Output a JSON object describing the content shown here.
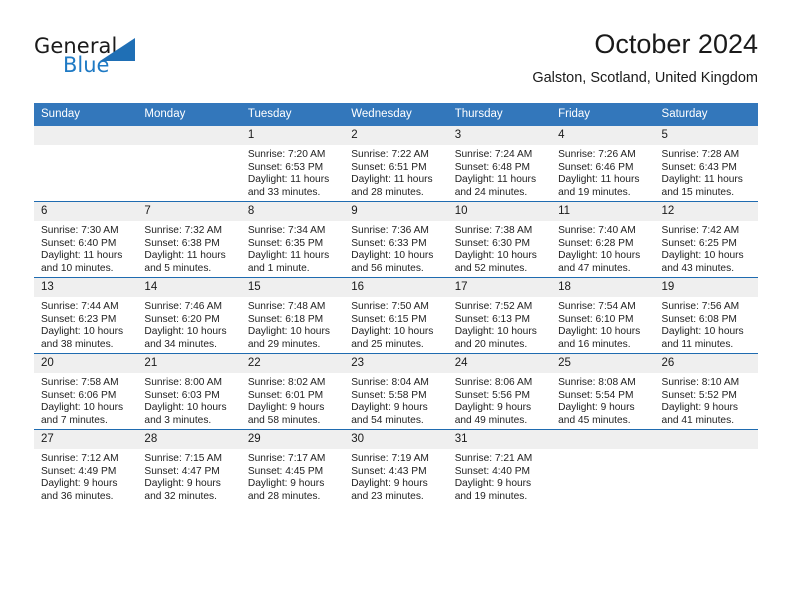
{
  "brand": {
    "name_part1": "General",
    "name_part2": "Blue",
    "logo_icon": "triangle-icon"
  },
  "header": {
    "title": "October 2024",
    "subtitle": "Galston, Scotland, United Kingdom"
  },
  "colors": {
    "header_blue": "#3377bb",
    "row_divider_blue": "#1f6bb0",
    "daynum_band": "#efefef",
    "brand_blue": "#1f7ac4",
    "text": "#1a1a1a"
  },
  "weekday_headers": [
    "Sunday",
    "Monday",
    "Tuesday",
    "Wednesday",
    "Thursday",
    "Friday",
    "Saturday"
  ],
  "weeks": [
    [
      {
        "day": "",
        "blank": true
      },
      {
        "day": "",
        "blank": true
      },
      {
        "day": "1",
        "sunrise": "Sunrise: 7:20 AM",
        "sunset": "Sunset: 6:53 PM",
        "daylight": "Daylight: 11 hours and 33 minutes."
      },
      {
        "day": "2",
        "sunrise": "Sunrise: 7:22 AM",
        "sunset": "Sunset: 6:51 PM",
        "daylight": "Daylight: 11 hours and 28 minutes."
      },
      {
        "day": "3",
        "sunrise": "Sunrise: 7:24 AM",
        "sunset": "Sunset: 6:48 PM",
        "daylight": "Daylight: 11 hours and 24 minutes."
      },
      {
        "day": "4",
        "sunrise": "Sunrise: 7:26 AM",
        "sunset": "Sunset: 6:46 PM",
        "daylight": "Daylight: 11 hours and 19 minutes."
      },
      {
        "day": "5",
        "sunrise": "Sunrise: 7:28 AM",
        "sunset": "Sunset: 6:43 PM",
        "daylight": "Daylight: 11 hours and 15 minutes."
      }
    ],
    [
      {
        "day": "6",
        "sunrise": "Sunrise: 7:30 AM",
        "sunset": "Sunset: 6:40 PM",
        "daylight": "Daylight: 11 hours and 10 minutes."
      },
      {
        "day": "7",
        "sunrise": "Sunrise: 7:32 AM",
        "sunset": "Sunset: 6:38 PM",
        "daylight": "Daylight: 11 hours and 5 minutes."
      },
      {
        "day": "8",
        "sunrise": "Sunrise: 7:34 AM",
        "sunset": "Sunset: 6:35 PM",
        "daylight": "Daylight: 11 hours and 1 minute."
      },
      {
        "day": "9",
        "sunrise": "Sunrise: 7:36 AM",
        "sunset": "Sunset: 6:33 PM",
        "daylight": "Daylight: 10 hours and 56 minutes."
      },
      {
        "day": "10",
        "sunrise": "Sunrise: 7:38 AM",
        "sunset": "Sunset: 6:30 PM",
        "daylight": "Daylight: 10 hours and 52 minutes."
      },
      {
        "day": "11",
        "sunrise": "Sunrise: 7:40 AM",
        "sunset": "Sunset: 6:28 PM",
        "daylight": "Daylight: 10 hours and 47 minutes."
      },
      {
        "day": "12",
        "sunrise": "Sunrise: 7:42 AM",
        "sunset": "Sunset: 6:25 PM",
        "daylight": "Daylight: 10 hours and 43 minutes."
      }
    ],
    [
      {
        "day": "13",
        "sunrise": "Sunrise: 7:44 AM",
        "sunset": "Sunset: 6:23 PM",
        "daylight": "Daylight: 10 hours and 38 minutes."
      },
      {
        "day": "14",
        "sunrise": "Sunrise: 7:46 AM",
        "sunset": "Sunset: 6:20 PM",
        "daylight": "Daylight: 10 hours and 34 minutes."
      },
      {
        "day": "15",
        "sunrise": "Sunrise: 7:48 AM",
        "sunset": "Sunset: 6:18 PM",
        "daylight": "Daylight: 10 hours and 29 minutes."
      },
      {
        "day": "16",
        "sunrise": "Sunrise: 7:50 AM",
        "sunset": "Sunset: 6:15 PM",
        "daylight": "Daylight: 10 hours and 25 minutes."
      },
      {
        "day": "17",
        "sunrise": "Sunrise: 7:52 AM",
        "sunset": "Sunset: 6:13 PM",
        "daylight": "Daylight: 10 hours and 20 minutes."
      },
      {
        "day": "18",
        "sunrise": "Sunrise: 7:54 AM",
        "sunset": "Sunset: 6:10 PM",
        "daylight": "Daylight: 10 hours and 16 minutes."
      },
      {
        "day": "19",
        "sunrise": "Sunrise: 7:56 AM",
        "sunset": "Sunset: 6:08 PM",
        "daylight": "Daylight: 10 hours and 11 minutes."
      }
    ],
    [
      {
        "day": "20",
        "sunrise": "Sunrise: 7:58 AM",
        "sunset": "Sunset: 6:06 PM",
        "daylight": "Daylight: 10 hours and 7 minutes."
      },
      {
        "day": "21",
        "sunrise": "Sunrise: 8:00 AM",
        "sunset": "Sunset: 6:03 PM",
        "daylight": "Daylight: 10 hours and 3 minutes."
      },
      {
        "day": "22",
        "sunrise": "Sunrise: 8:02 AM",
        "sunset": "Sunset: 6:01 PM",
        "daylight": "Daylight: 9 hours and 58 minutes."
      },
      {
        "day": "23",
        "sunrise": "Sunrise: 8:04 AM",
        "sunset": "Sunset: 5:58 PM",
        "daylight": "Daylight: 9 hours and 54 minutes."
      },
      {
        "day": "24",
        "sunrise": "Sunrise: 8:06 AM",
        "sunset": "Sunset: 5:56 PM",
        "daylight": "Daylight: 9 hours and 49 minutes."
      },
      {
        "day": "25",
        "sunrise": "Sunrise: 8:08 AM",
        "sunset": "Sunset: 5:54 PM",
        "daylight": "Daylight: 9 hours and 45 minutes."
      },
      {
        "day": "26",
        "sunrise": "Sunrise: 8:10 AM",
        "sunset": "Sunset: 5:52 PM",
        "daylight": "Daylight: 9 hours and 41 minutes."
      }
    ],
    [
      {
        "day": "27",
        "sunrise": "Sunrise: 7:12 AM",
        "sunset": "Sunset: 4:49 PM",
        "daylight": "Daylight: 9 hours and 36 minutes."
      },
      {
        "day": "28",
        "sunrise": "Sunrise: 7:15 AM",
        "sunset": "Sunset: 4:47 PM",
        "daylight": "Daylight: 9 hours and 32 minutes."
      },
      {
        "day": "29",
        "sunrise": "Sunrise: 7:17 AM",
        "sunset": "Sunset: 4:45 PM",
        "daylight": "Daylight: 9 hours and 28 minutes."
      },
      {
        "day": "30",
        "sunrise": "Sunrise: 7:19 AM",
        "sunset": "Sunset: 4:43 PM",
        "daylight": "Daylight: 9 hours and 23 minutes."
      },
      {
        "day": "31",
        "sunrise": "Sunrise: 7:21 AM",
        "sunset": "Sunset: 4:40 PM",
        "daylight": "Daylight: 9 hours and 19 minutes."
      },
      {
        "day": "",
        "blank": true
      },
      {
        "day": "",
        "blank": true
      }
    ]
  ]
}
